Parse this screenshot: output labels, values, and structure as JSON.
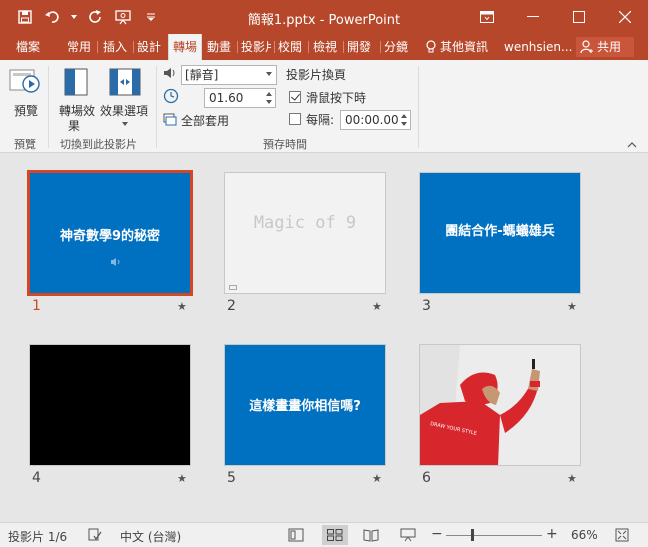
{
  "titlebar": {
    "title": "簡報1.pptx - PowerPoint",
    "restore_icon": "ribbon-display-icon",
    "colors": {
      "brand": "#b7472a"
    }
  },
  "tabs": [
    {
      "label": "檔案"
    },
    {
      "label": "常用"
    },
    {
      "label": "插入"
    },
    {
      "label": "設計"
    },
    {
      "label": "轉場",
      "active": true
    },
    {
      "label": "動畫"
    },
    {
      "label": "投影片"
    },
    {
      "label": "校閱"
    },
    {
      "label": "檢視"
    },
    {
      "label": "開發"
    },
    {
      "label": "分鏡"
    }
  ],
  "tell_me": "其他資訊",
  "user": "wenhsien...",
  "share_label": "共用",
  "ribbon": {
    "preview_label": "預覽",
    "transition_effects_label_1": "轉場效",
    "transition_effects_label_2": "果",
    "effect_options_label": "效果選項",
    "sound_value": "[靜音]",
    "duration_value": "01.60",
    "apply_all_label": "全部套用",
    "advance_slide_label": "投影片換頁",
    "on_click_label": "滑鼠按下時",
    "on_click_checked": true,
    "after_label": "每隔:",
    "after_value": "00:00.00",
    "after_checked": false,
    "groups": {
      "preview": "預覽",
      "transition": "切換到此投影片",
      "timing": "預存時間"
    }
  },
  "slides": [
    {
      "number": "1",
      "title": "神奇數學9的秘密",
      "bg": "#0070c0",
      "has_sound": true,
      "selected": true
    },
    {
      "number": "2",
      "title": "Magic of 9",
      "bg": "#f2f2f2"
    },
    {
      "number": "3",
      "title": "團結合作-螞蟻雄兵",
      "bg": "#0070c0"
    },
    {
      "number": "4",
      "title": "",
      "bg": "#000000"
    },
    {
      "number": "5",
      "title": "這樣畫畫你相信嗎?",
      "bg": "#0070c0"
    },
    {
      "number": "6",
      "title": "",
      "bg": "#e8e8e8",
      "photo": true,
      "shirt_text": "DRAW YOUR STYLE"
    }
  ],
  "status": {
    "slide_count": "投影片 1/6",
    "language": "中文 (台灣)",
    "zoom": "66%"
  }
}
